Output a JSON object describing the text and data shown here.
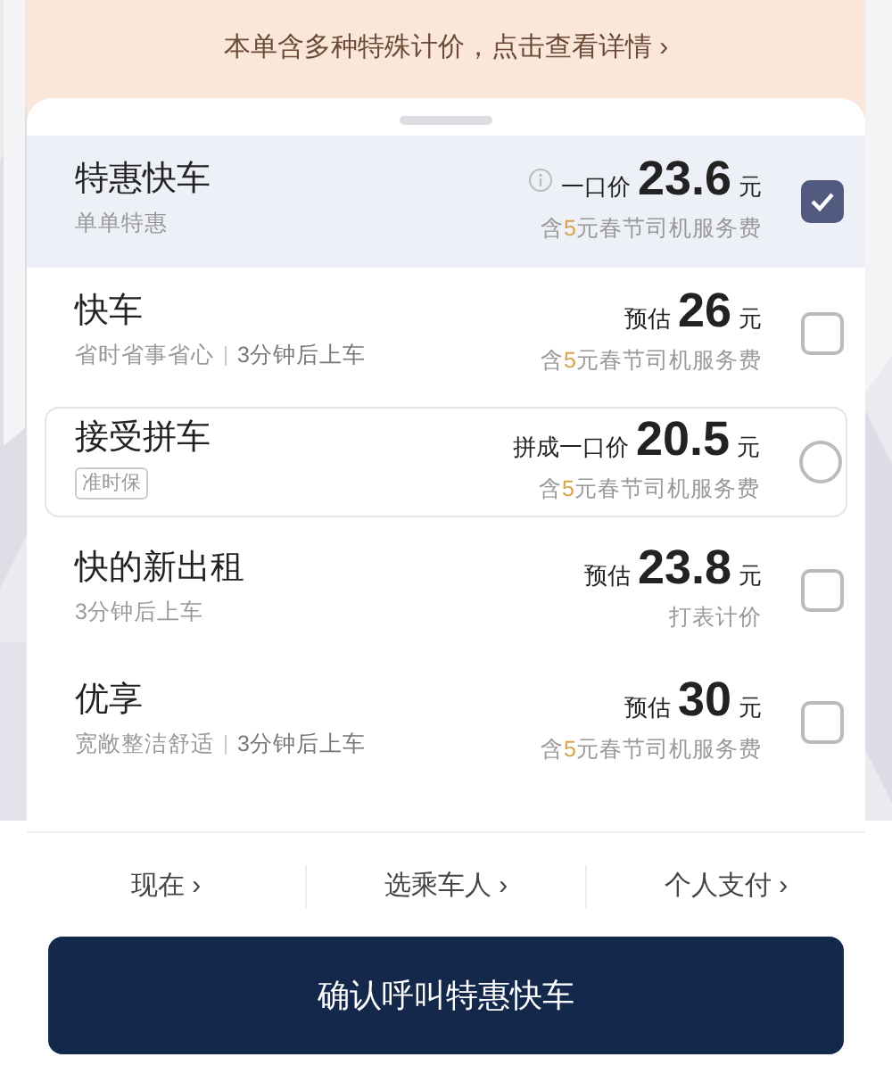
{
  "notice": {
    "text": "本单含多种特殊计价，点击查看详情",
    "chevron": "›"
  },
  "options": [
    {
      "kind": "option",
      "name": "特惠快车",
      "tags": [
        "单单特惠"
      ],
      "info": true,
      "price_label": "一口价",
      "price": "23.6",
      "unit": "元",
      "fee": {
        "before": "含",
        "amount": "5",
        "after": "元春节司机服务费"
      },
      "selected": true
    },
    {
      "kind": "option",
      "name": "快车",
      "tags": [
        "省时省事省心",
        "3分钟后上车"
      ],
      "info": false,
      "price_label": "预估",
      "price": "26",
      "unit": "元",
      "fee": {
        "before": "含",
        "amount": "5",
        "after": "元春节司机服务费"
      },
      "selected": false
    },
    {
      "kind": "carpool",
      "name": "接受拼车",
      "badge": "准时保",
      "info": false,
      "price_label": "拼成一口价",
      "price": "20.5",
      "unit": "元",
      "fee": {
        "before": "含",
        "amount": "5",
        "after": "元春节司机服务费"
      },
      "selected": false
    },
    {
      "kind": "option",
      "name": "快的新出租",
      "tags": [
        "3分钟后上车"
      ],
      "info": false,
      "price_label": "预估",
      "price": "23.8",
      "unit": "元",
      "note": "打表计价",
      "selected": false
    },
    {
      "kind": "option",
      "name": "优享",
      "tags": [
        "宽敞整洁舒适",
        "3分钟后上车"
      ],
      "info": false,
      "price_label": "预估",
      "price": "30",
      "unit": "元",
      "fee": {
        "before": "含",
        "amount": "5",
        "after": "元春节司机服务费"
      },
      "selected": false
    }
  ],
  "footer_links": [
    {
      "label": "现在",
      "chevron": "›"
    },
    {
      "label": "选乘车人",
      "chevron": "›"
    },
    {
      "label": "个人支付",
      "chevron": "›"
    }
  ],
  "confirm_button": "确认呼叫特惠快车"
}
